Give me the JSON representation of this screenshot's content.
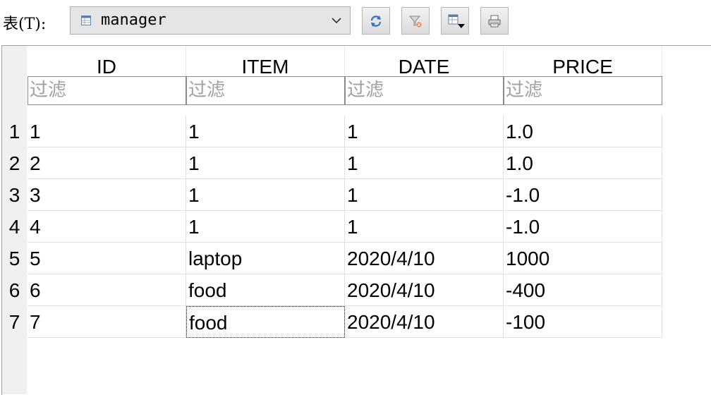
{
  "toolbar": {
    "table_label": "表(T):",
    "table_select": {
      "selected": "manager",
      "icon": "table-icon"
    },
    "buttons": [
      {
        "name": "refresh-button",
        "icon": "refresh-icon"
      },
      {
        "name": "clear-filter-button",
        "icon": "filter-clear-icon"
      },
      {
        "name": "export-button",
        "icon": "export-dropdown-icon"
      },
      {
        "name": "print-button",
        "icon": "print-icon"
      }
    ]
  },
  "grid": {
    "columns": [
      {
        "header": "ID",
        "filter_placeholder": "过滤"
      },
      {
        "header": "ITEM",
        "filter_placeholder": "过滤"
      },
      {
        "header": "DATE",
        "filter_placeholder": "过滤"
      },
      {
        "header": "PRICE",
        "filter_placeholder": "过滤"
      }
    ],
    "rows": [
      {
        "num": "1",
        "cells": [
          "1",
          "1",
          "1",
          "1.0"
        ]
      },
      {
        "num": "2",
        "cells": [
          "2",
          "1",
          "1",
          "1.0"
        ]
      },
      {
        "num": "3",
        "cells": [
          "3",
          "1",
          "1",
          "-1.0"
        ]
      },
      {
        "num": "4",
        "cells": [
          "4",
          "1",
          "1",
          "-1.0"
        ]
      },
      {
        "num": "5",
        "cells": [
          "5",
          "laptop",
          "2020/4/10",
          "1000"
        ]
      },
      {
        "num": "6",
        "cells": [
          "6",
          "food",
          "2020/4/10",
          "-400"
        ]
      },
      {
        "num": "7",
        "cells": [
          "7",
          "food",
          "2020/4/10",
          "-100"
        ]
      }
    ],
    "focused_cell": {
      "row": 7,
      "column": "ITEM"
    }
  },
  "colors": {
    "toolbar_button_blue": "#2e6fc4",
    "filter_placeholder": "#a0a0a0",
    "gutter": "#f0f0f0"
  }
}
